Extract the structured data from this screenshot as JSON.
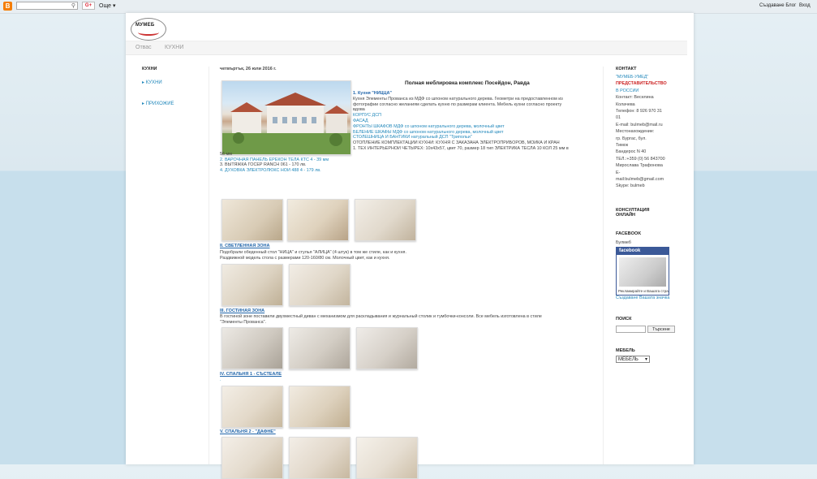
{
  "navbar": {
    "logo": "B",
    "search_placeholder": "",
    "gplus": "G+",
    "more": "Още ▾",
    "create_blog": "Създаване Блог",
    "sign_in": "Вход"
  },
  "header": {
    "logo_text": "МУМЕБ",
    "tabs": [
      "Отвас",
      "КУХНИ"
    ]
  },
  "left_sidebar": {
    "title": "КУХНИ",
    "items": [
      "КУХНИ",
      "ПРИХОЖИЕ"
    ]
  },
  "post": {
    "date": "четвъртък, 26 юли 2016 г.",
    "title": "Полная меблировка комплекс Посейдон, Равда",
    "intro_lines": [
      {
        "text": "1. Кухня \"НИЦЦА\"",
        "style": "boldblue"
      },
      {
        "text": "Кухня Элементы Прованса из МДФ со шпоном натурального дерева. Геометри на предоставленном из",
        "style": "txt"
      },
      {
        "text": "фотографии согласно желаниям сделать кухню по размерам клиента. Мебель кухни согласно проекту",
        "style": "txt"
      },
      {
        "text": "вдова",
        "style": "txt"
      },
      {
        "text": "КОРПУС ДСП",
        "style": "blue"
      },
      {
        "text": "ФАСАД",
        "style": "blue"
      },
      {
        "text": "ФРОНТЫ ШКАФОВ МДФ со шпоном натурального дерева, молочный цвет",
        "style": "blue"
      },
      {
        "text": "БЕЛЕНИЕ ШКАФЫ МДФ со шпоном натурального дерева, молочный цвет",
        "style": "blue"
      },
      {
        "text": "СТОЛЕШНИЦА И БАНТИКИ натуральный ДСП \"Трипольи\"",
        "style": "blue"
      },
      {
        "text": "ОТОПЛЕНИЕ КОМПЛЕКТАЦИИ КУХНИ: КУХНЯ С ЗАКАЗАНА ЭЛЕКТРОПРИБОРОВ, МОЙКА И КРАН",
        "style": "txt"
      },
      {
        "text": "1. ТЕХ ИНТЕРЬЕРНОЙ ЧЕТЫРЕХ: 10х43х57, цвет 70, размер 18 тип ЭЛЕКТРИКА ТЕСЛА 10 КОЛ 25 мм в",
        "style": "txt"
      },
      {
        "text": "56 мм",
        "style": "txt"
      },
      {
        "text": "2. ВАРОЧНАЯ ПАНЕЛЬ ЕРЕКОН ТЕЛА КТС 4 - 39 мм",
        "style": "blue"
      },
      {
        "text": "3. ВЫТЯЖКА ГОСЕР RANCH 061 - 170 лв.",
        "style": "txt"
      },
      {
        "text": "4. ДУХОВКА ЭЛЕКТРОЛЮКС НОЙ 488 4 - 179 лв.",
        "style": "blue"
      }
    ],
    "sections": [
      {
        "heading": "II. СВЕТЛЕННАЯ ЗОНА",
        "lines": [
          "Подобрали обеденный стол \"НИЦА\" и стулья \"АЛИЦА\" (4 штук) в том же стиле, как и кухня.",
          "Раздвижной модель стола с размерами 120-160/80 см. Молочный цвет, как и кухня."
        ]
      },
      {
        "heading": "III. ГОСТИНАЯ ЗОНА",
        "lines": [
          "В гостиной зоне поставили двухместный диван с механизмом для раскладывания и журнальный столик и тумбочки-консоли. Все мебель изготовлена в стиле",
          "\"Элементы Прованса\"."
        ]
      },
      {
        "heading": "IV. СПАЛЬНЯ 1 - СЪСТЕАЛЕ",
        "lines": []
      },
      {
        "heading": "V. СПАЛЬНЯ 2 - \"ДАФНЕ\"",
        "lines": []
      }
    ]
  },
  "right_sidebar": {
    "contact_title": "КОНТАКТ",
    "contact_lines": [
      {
        "text": "\"МУМЕБ-УМЕД\"",
        "style": "r-link"
      },
      {
        "text": "ПРЕДСТАВИТЕЛЬСТВО",
        "style": "r-red"
      },
      {
        "text": "В РОССИИ",
        "style": "r-link"
      },
      {
        "text": "Контакт: Веселина",
        "style": ""
      },
      {
        "text": "Колачева",
        "style": ""
      },
      {
        "text": "Телефон: 8 926 970 31",
        "style": ""
      },
      {
        "text": "01",
        "style": ""
      },
      {
        "text": "E-mail: bulmeb@mail.ru",
        "style": ""
      },
      {
        "text": "Местонахождение:",
        "style": ""
      },
      {
        "text": "гр. Бургас, бул.",
        "style": ""
      },
      {
        "text": "Тимок",
        "style": ""
      },
      {
        "text": "Бандерос N 40",
        "style": ""
      },
      {
        "text": "ТЕЛ.:+359 (0) 56 843700",
        "style": ""
      },
      {
        "text": "Мирослава Трафонова",
        "style": ""
      },
      {
        "text": "E-",
        "style": ""
      },
      {
        "text": "mail:bulmeb@gmail.com",
        "style": ""
      },
      {
        "text": "Skype: bulmeb",
        "style": ""
      }
    ],
    "consult_title": "КОНСУЛТАЦИЯ ОНЛАЙН",
    "facebook_title": "FACEBOOK",
    "facebook_sub": "Булмеб",
    "facebook_badge": "facebook",
    "facebook_promo": "Рекламирайте и Вашата страница",
    "facebook_link": "Създаване Вашата значка",
    "search_title": "ПОИСК",
    "search_button": "Търсене",
    "menu_title": "МЕБЕЛЬ",
    "menu_select": "МЕБЕЛЬ"
  },
  "colors": {
    "link": "#2288bb",
    "accent_red": "#cc2222",
    "blogger_orange": "#f57d00"
  }
}
